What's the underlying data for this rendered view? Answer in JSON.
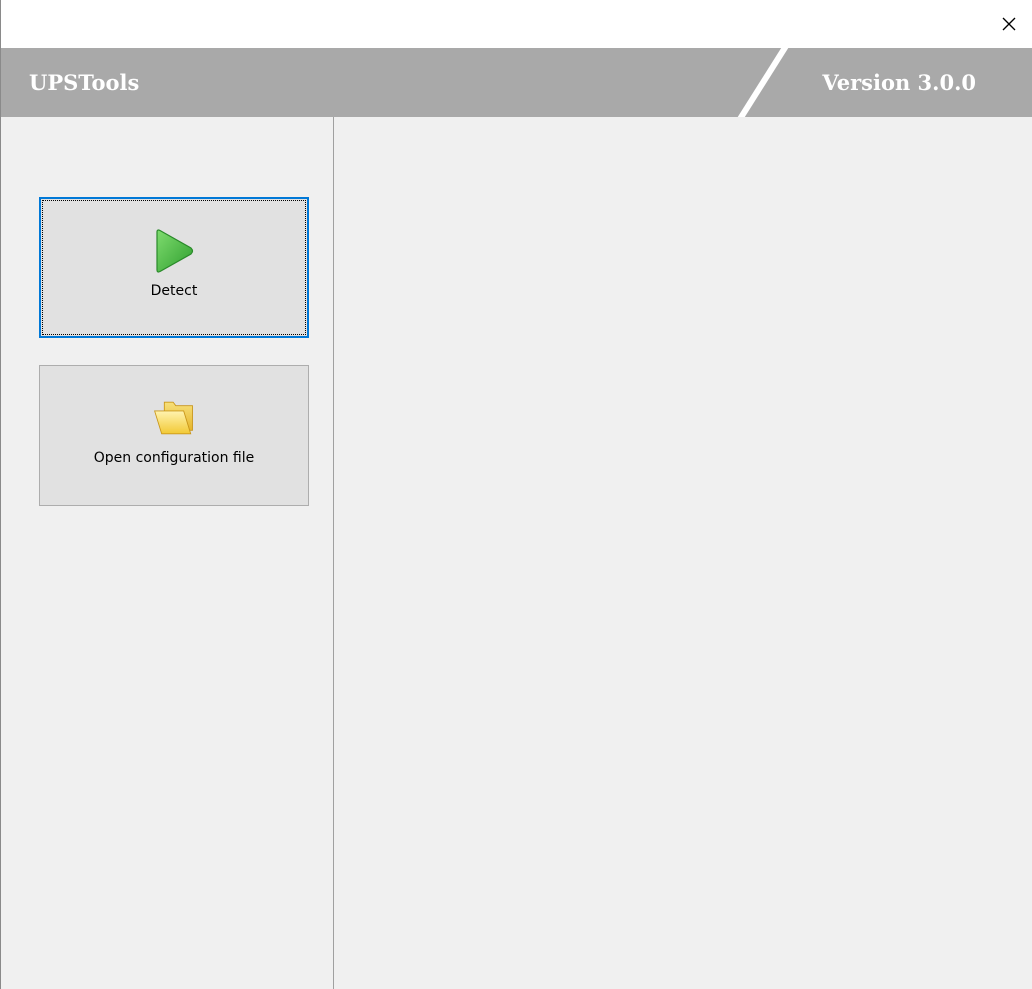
{
  "window": {
    "close_glyph": "✕"
  },
  "banner": {
    "app_title": "UPSTools",
    "version": "Version 3.0.0"
  },
  "sidebar": {
    "buttons": [
      {
        "label": "Detect",
        "icon": "play-icon"
      },
      {
        "label": "Open configuration file",
        "icon": "folder-icon"
      }
    ]
  },
  "colors": {
    "banner_bg": "#a9a9a9",
    "banner_text": "#ffffff",
    "focus_border": "#0078d7",
    "play_green": "#3cb043",
    "folder_yellow": "#f5d43a"
  }
}
